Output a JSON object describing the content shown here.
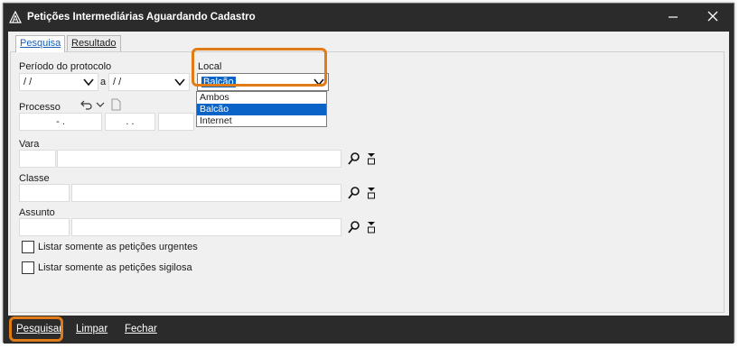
{
  "window": {
    "title": "Petições Intermediárias Aguardando Cadastro",
    "minimize_icon": "minimize-icon",
    "close_icon": "close-icon"
  },
  "tabs": [
    {
      "label": "Pesquisa",
      "active": true
    },
    {
      "label": "Resultado",
      "active": false
    }
  ],
  "form": {
    "periodo_label": "Período do protocolo",
    "date_from": " / /",
    "date_sep": "a",
    "date_to": " / /",
    "local_label": "Local",
    "local_value": "Balcão",
    "local_options": [
      "Ambos",
      "Balcão",
      "Internet"
    ],
    "processo_label": "Processo",
    "processo_part1": "- .",
    "processo_part2": ". .",
    "vara_label": "Vara",
    "classe_label": "Classe",
    "assunto_label": "Assunto",
    "check_urgentes": "Listar somente as petições urgentes",
    "check_sigilosas": "Listar somente as petições sigilosa"
  },
  "footer": {
    "pesquisar": "Pesquisar",
    "limpar": "Limpar",
    "fechar": "Fechar"
  },
  "colors": {
    "highlight": "#e07b16",
    "selection": "#0a64c8",
    "chrome": "#2b2b2b"
  }
}
